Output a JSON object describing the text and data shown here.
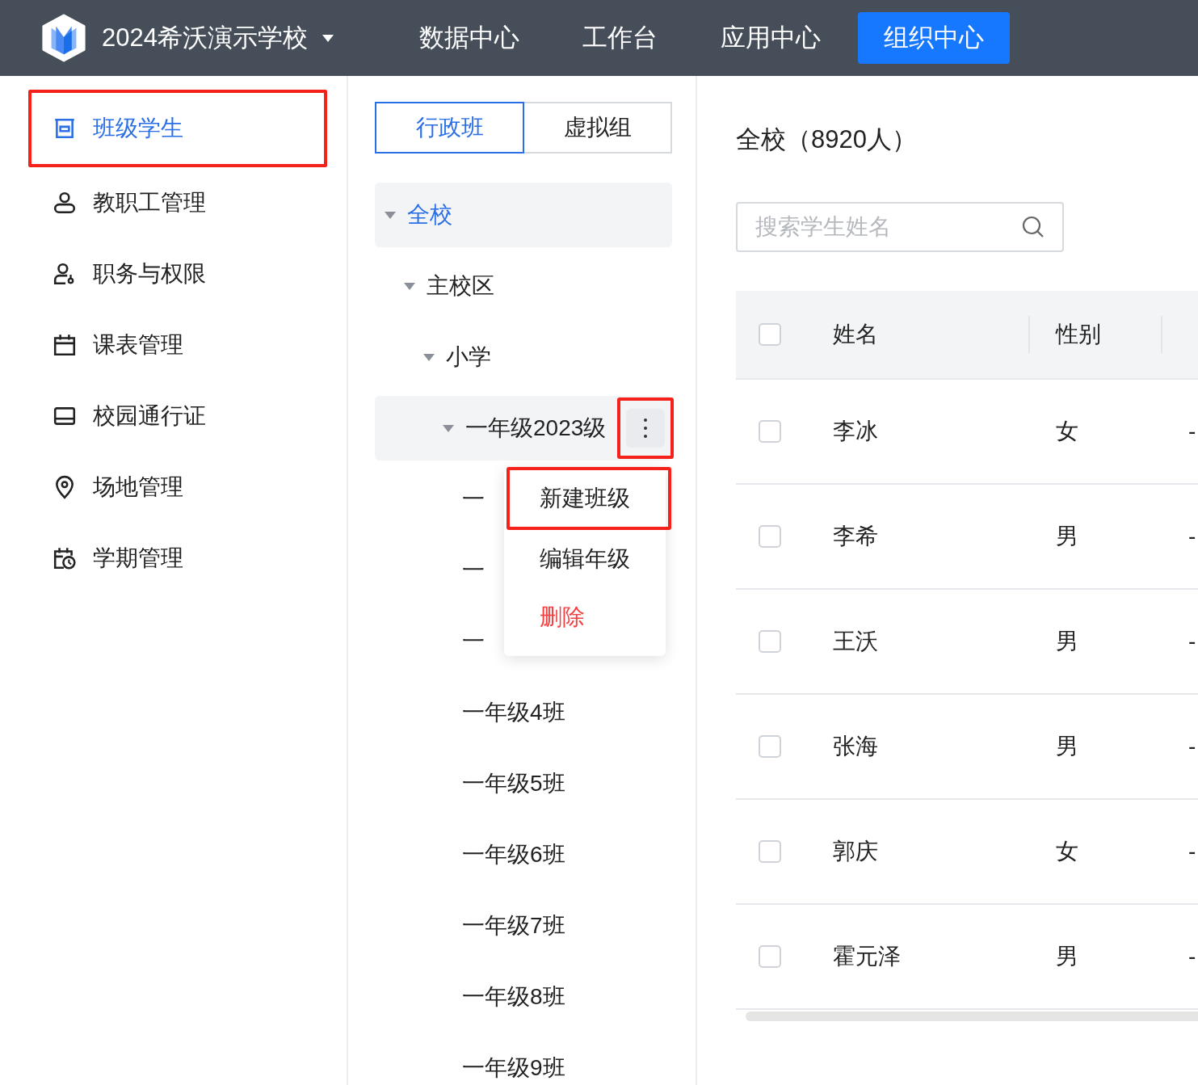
{
  "header": {
    "school": "2024希沃演示学校",
    "nav": [
      {
        "label": "数据中心",
        "selected": false
      },
      {
        "label": "工作台",
        "selected": false
      },
      {
        "label": "应用中心",
        "selected": false
      },
      {
        "label": "组织中心",
        "selected": true
      }
    ]
  },
  "sidebar": {
    "items": [
      {
        "label": "班级学生",
        "selected": true,
        "highlighted": true
      },
      {
        "label": "教职工管理",
        "selected": false,
        "highlighted": false
      },
      {
        "label": "职务与权限",
        "selected": false,
        "highlighted": false
      },
      {
        "label": "课表管理",
        "selected": false,
        "highlighted": false
      },
      {
        "label": "校园通行证",
        "selected": false,
        "highlighted": false
      },
      {
        "label": "场地管理",
        "selected": false,
        "highlighted": false
      },
      {
        "label": "学期管理",
        "selected": false,
        "highlighted": false
      }
    ]
  },
  "tabs": [
    {
      "label": "行政班",
      "selected": true
    },
    {
      "label": "虚拟组",
      "selected": false
    }
  ],
  "tree": [
    {
      "label": "全校",
      "selected": true,
      "hovered": false,
      "expanded": true,
      "children": [
        {
          "label": "主校区",
          "selected": false,
          "hovered": false,
          "expanded": true,
          "children": [
            {
              "label": "小学",
              "selected": false,
              "hovered": false,
              "expanded": true,
              "children": [
                {
                  "label": "一年级2023级",
                  "selected": false,
                  "hovered": true,
                  "expanded": true,
                  "more_highlighted": true,
                  "children": [
                    {
                      "label": "一",
                      "selected": false,
                      "hovered": false
                    },
                    {
                      "label": "一",
                      "selected": false,
                      "hovered": false
                    },
                    {
                      "label": "一",
                      "selected": false,
                      "hovered": false
                    },
                    {
                      "label": "一年级4班",
                      "selected": false,
                      "hovered": false
                    },
                    {
                      "label": "一年级5班",
                      "selected": false,
                      "hovered": false
                    },
                    {
                      "label": "一年级6班",
                      "selected": false,
                      "hovered": false
                    },
                    {
                      "label": "一年级7班",
                      "selected": false,
                      "hovered": false
                    },
                    {
                      "label": "一年级8班",
                      "selected": false,
                      "hovered": false
                    },
                    {
                      "label": "一年级9班",
                      "selected": false,
                      "hovered": false
                    }
                  ]
                }
              ]
            }
          ]
        }
      ]
    }
  ],
  "context_menu": [
    {
      "label": "新建班级",
      "kind": "normal",
      "highlighted": true
    },
    {
      "label": "编辑年级",
      "kind": "normal",
      "highlighted": false
    },
    {
      "label": "删除",
      "kind": "danger",
      "highlighted": false
    }
  ],
  "content": {
    "title": "全校（8920人）",
    "search": {
      "placeholder": "搜索学生姓名"
    },
    "table": {
      "select_all_checked": false,
      "columns": [
        "姓名",
        "性别"
      ],
      "rows": [
        {
          "checked": false,
          "cells": [
            "李冰",
            "女",
            "-"
          ]
        },
        {
          "checked": false,
          "cells": [
            "李希",
            "男",
            "-"
          ]
        },
        {
          "checked": false,
          "cells": [
            "王沃",
            "男",
            "-"
          ]
        },
        {
          "checked": false,
          "cells": [
            "张海",
            "男",
            "-"
          ]
        },
        {
          "checked": false,
          "cells": [
            "郭庆",
            "女",
            "-"
          ]
        },
        {
          "checked": false,
          "cells": [
            "霍元泽",
            "男",
            "-"
          ]
        }
      ]
    }
  }
}
